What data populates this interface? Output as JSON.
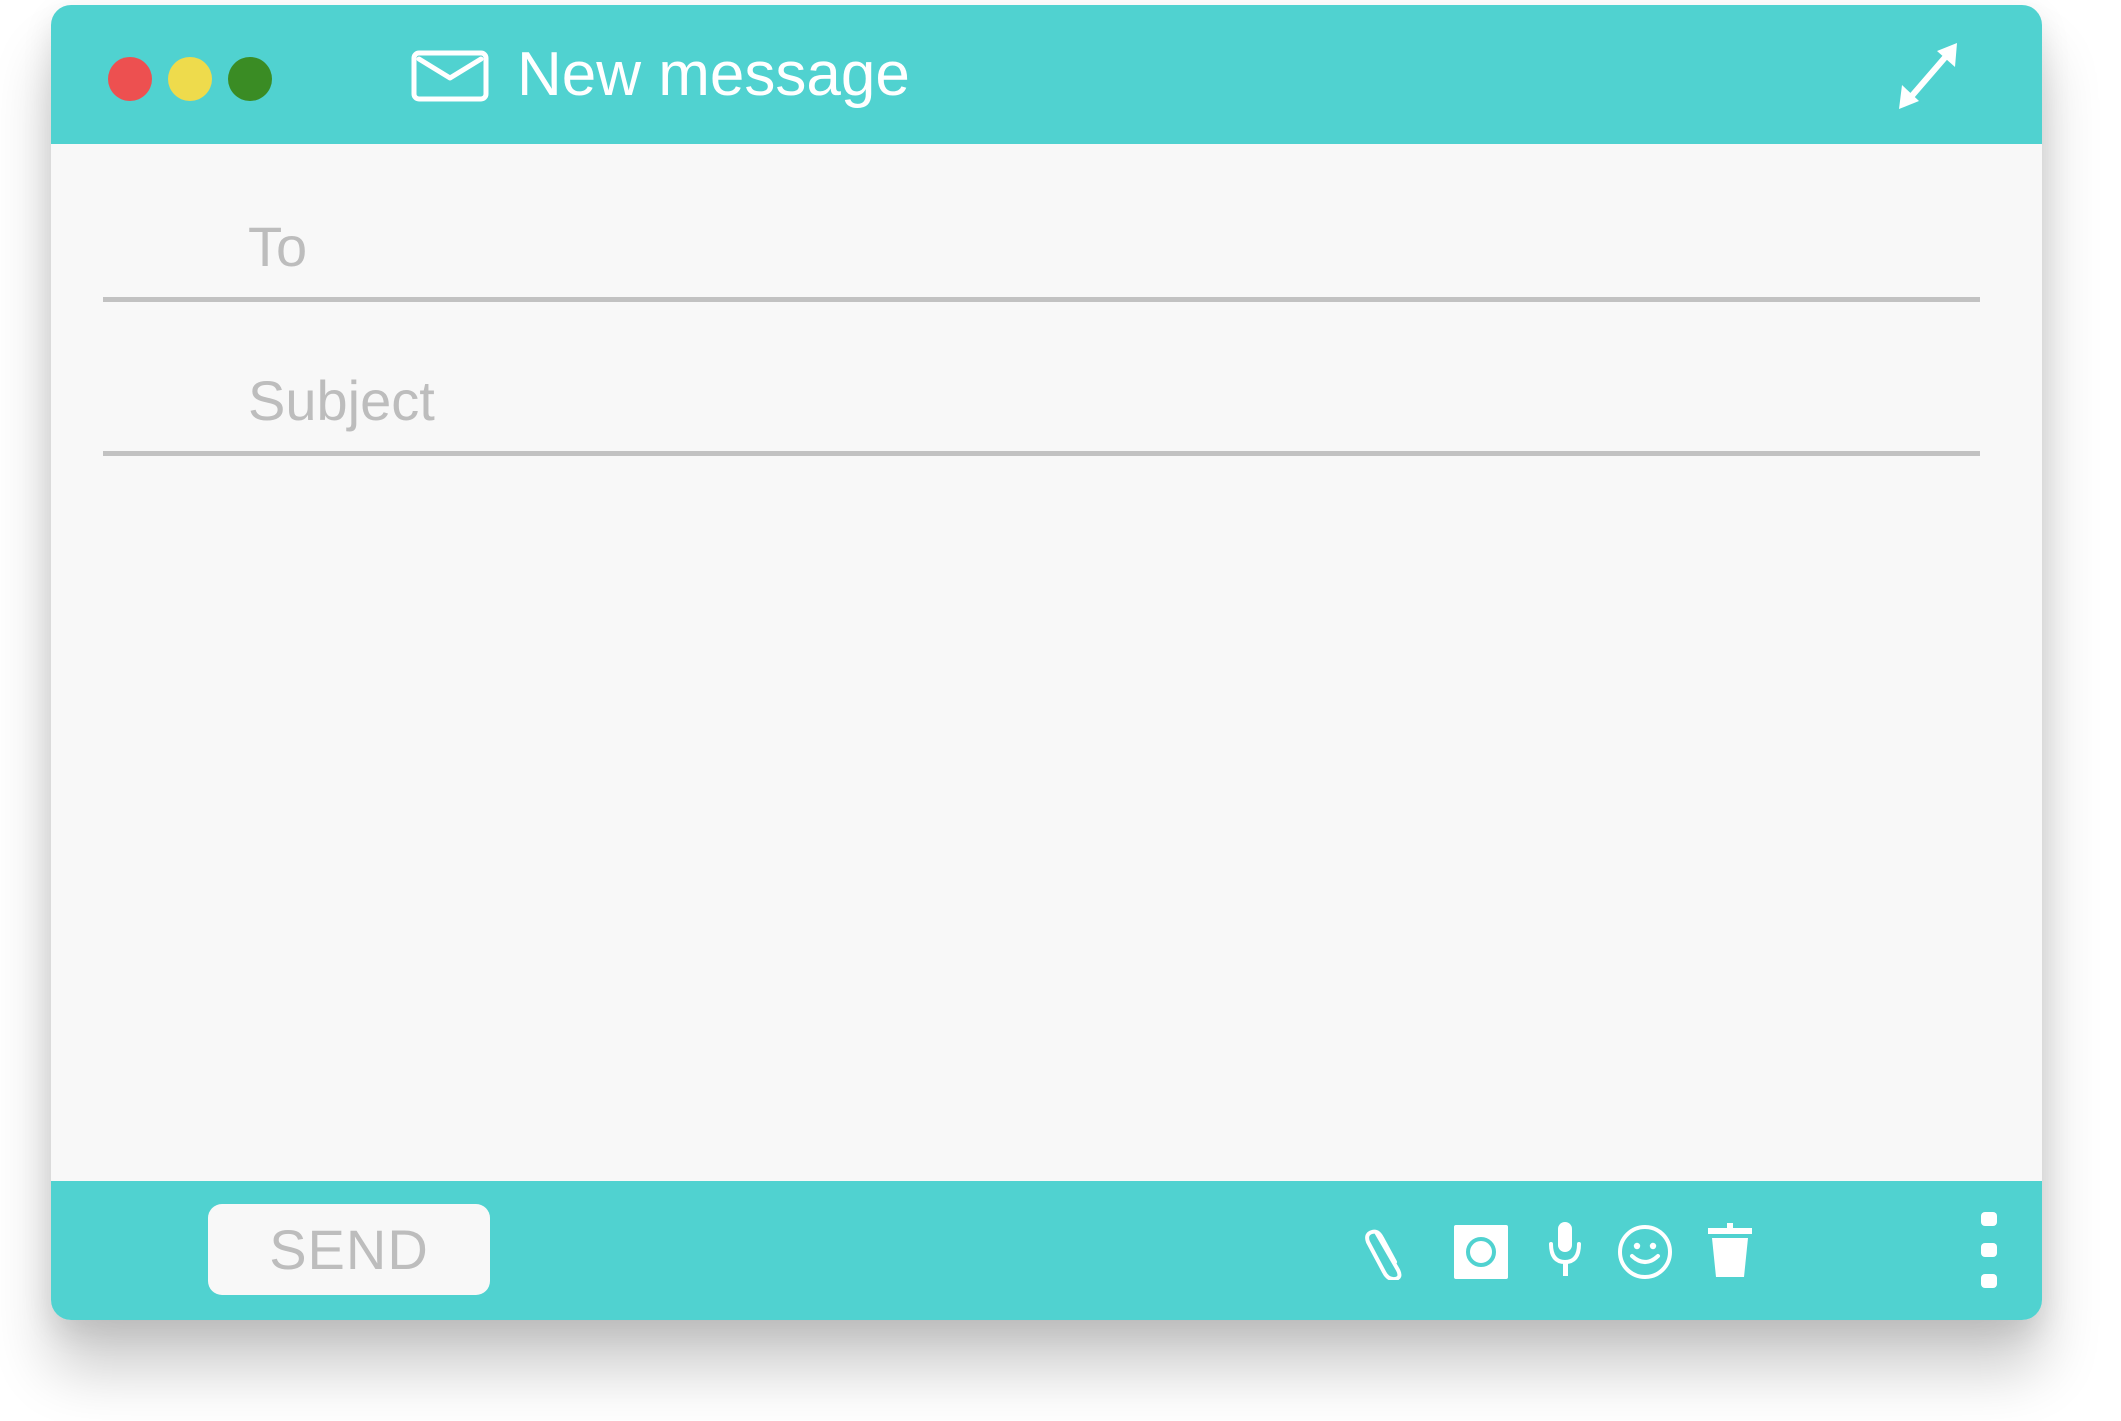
{
  "window": {
    "title": "New message",
    "lights": {
      "close_color": "#ed5050",
      "minimize_color": "#eedb4c",
      "maximize_color": "#3a8c24"
    },
    "accent_color": "#50d2d0"
  },
  "fields": {
    "to_placeholder": "To",
    "subject_placeholder": "Subject"
  },
  "footer": {
    "send_label": "SEND",
    "tools": [
      "paperclip-icon",
      "image-icon",
      "microphone-icon",
      "smiley-icon",
      "trash-icon",
      "more-vertical-icon"
    ]
  }
}
